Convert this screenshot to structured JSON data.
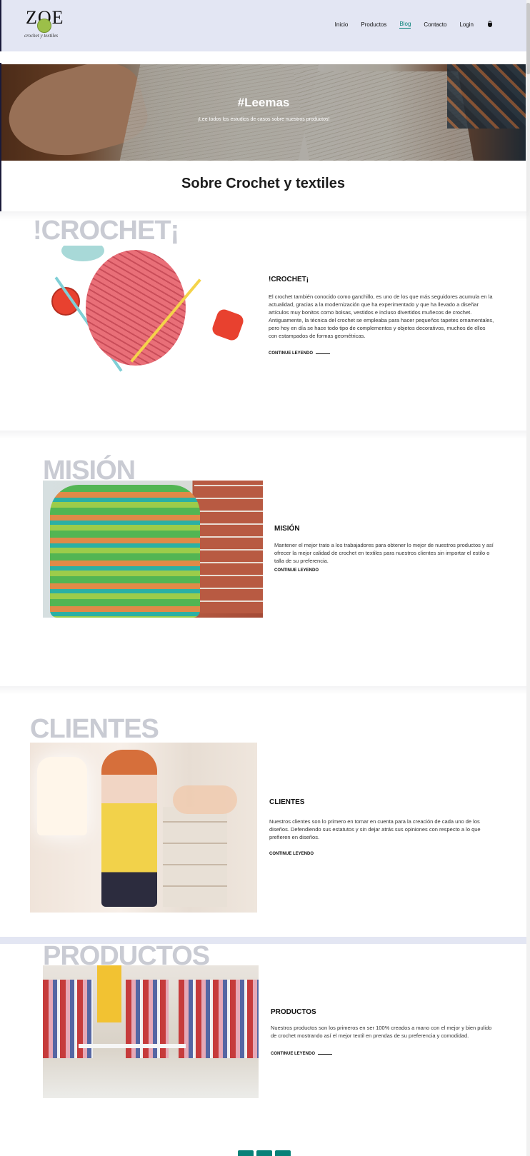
{
  "header": {
    "logo_text": "ZOE",
    "logo_sub": "crochet y textiles",
    "nav": [
      "Inicio",
      "Productos",
      "Blog",
      "Contacto",
      "Login"
    ],
    "active_nav": "Blog",
    "accent_color": "#088178"
  },
  "hero": {
    "title": "#Leemas",
    "subtitle": "¡Lee todos los estudios de casos sobre nuestros productos!"
  },
  "blog_heading": "Sobre Crochet y textiles",
  "posts": [
    {
      "bg_word": "!CROCHET¡",
      "title": "!CROCHET¡",
      "text": "El crochet también conocido como ganchillo, es uno de los que más seguidores acumula en la actualidad, gracias a la modernización que ha experimentado y que ha llevado a diseñar artículos muy bonitos como bolsas, vestidos e incluso divertidos muñecos de crochet. Antiguamente, la técnica del crochet se empleaba para hacer pequeños tapetes ornamentales, pero hoy en día se hace todo tipo de complementos y objetos decorativos, muchos de ellos con estampados de formas geométricas.",
      "link": "CONTINUE LEYENDO",
      "icon": "yarn-ball-image"
    },
    {
      "bg_word": "MISIÓN",
      "title": "MISIÓN",
      "text": "Mantener el mejor trato a los trabajadores para obtener lo mejor de nuestros productos y así ofrecer la mejor calidad de crochet en textiles para nuestros clientes sin importar el estilo o talla de su preferencia.",
      "link": "CONTINUE LEYENDO",
      "icon": "sweater-image"
    },
    {
      "bg_word": "CLIENTES",
      "title": "CLIENTES",
      "text": "Nuestros clientes son lo primero en tomar en cuenta para la creación de cada uno de los diseños. Defendiendo sus estatutos y sin dejar atrás sus opiniones con respecto a lo que prefieren en diseños.",
      "link": "CONTINUE LEYENDO",
      "icon": "store-customer-image"
    },
    {
      "bg_word": "PRODUCTOS",
      "title": "PRODUCTOS",
      "text": "Nuestros productos son los primeros en ser 100% creados a mano con el mejor y bien pulido de crochet mostrando así el mejor textil en prendas de su preferencia y comodidad.",
      "link": "CONTINUE LEYENDO",
      "icon": "clothing-store-image"
    }
  ]
}
